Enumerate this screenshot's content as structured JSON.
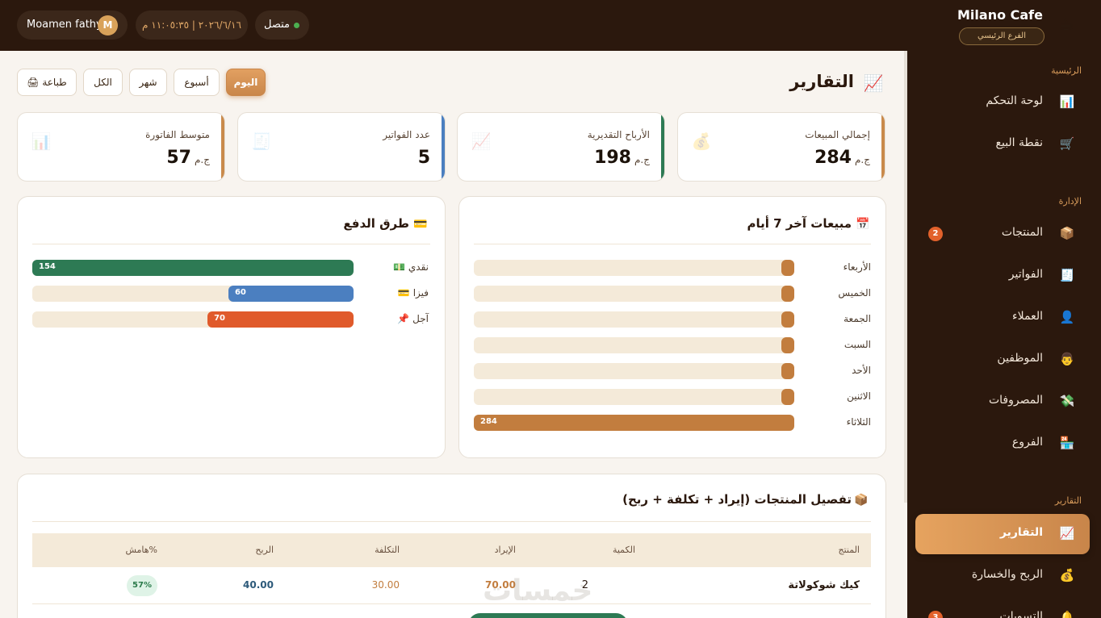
{
  "brand": {
    "title": "Milano Cafe",
    "branch": "الفرع الرئيسي",
    "icon": "coffee-cup-icon"
  },
  "topbar": {
    "status": "متصل",
    "datetime": "٢٠٢٦/٦/١٦ | ١١:٠٥:٣٥ م",
    "user_name": "Moamen fathy",
    "user_initial": "M"
  },
  "sidebar": {
    "sections": [
      {
        "title": "الرئيسية",
        "items": [
          {
            "label": "لوحة التحكم",
            "icon": "dashboard-icon"
          },
          {
            "label": "نقطة البيع",
            "icon": "cart-icon"
          }
        ]
      },
      {
        "title": "الإدارة",
        "items": [
          {
            "label": "المنتجات",
            "icon": "box-icon",
            "badge": "2"
          },
          {
            "label": "الفواتير",
            "icon": "receipt-icon"
          },
          {
            "label": "العملاء",
            "icon": "user-icon"
          },
          {
            "label": "الموظفين",
            "icon": "employee-icon"
          },
          {
            "label": "المصروفات",
            "icon": "money-wings-icon"
          },
          {
            "label": "الفروع",
            "icon": "store-icon"
          }
        ]
      },
      {
        "title": "التقارير",
        "items": [
          {
            "label": "التقارير",
            "icon": "chart-up-icon",
            "active": true
          },
          {
            "label": "الربح والخسارة",
            "icon": "money-bag-icon"
          },
          {
            "label": "التسويات",
            "icon": "bell-icon",
            "badge": "3"
          }
        ]
      }
    ]
  },
  "page": {
    "title": "التقارير",
    "icon": "chart-up-icon"
  },
  "filters": {
    "today": "اليوم",
    "week": "أسبوع",
    "month": "شهر",
    "all": "الكل",
    "print": "🖨 طباعة",
    "active": "today"
  },
  "stats": [
    {
      "label": "إجمالي المبيعات",
      "value": "284",
      "unit": "ج.م",
      "icon": "money-bag-icon",
      "accent": "#c98a4b"
    },
    {
      "label": "الأرباح التقديرية",
      "value": "198",
      "unit": "ج.م",
      "icon": "chart-up-icon",
      "accent": "#2d7a54"
    },
    {
      "label": "عدد الفواتير",
      "value": "5",
      "unit": "",
      "icon": "receipt-icon",
      "accent": "#4b7fc0"
    },
    {
      "label": "متوسط الفاتورة",
      "value": "57",
      "unit": "ج.م",
      "icon": "bar-chart-icon",
      "accent": "#c98a4b"
    }
  ],
  "sales_panel": {
    "title": "مبيعات آخر 7 أيام",
    "icon": "calendar-icon"
  },
  "payments_panel": {
    "title": "طرق الدفع",
    "icon": "credit-card-icon"
  },
  "chart_data": [
    {
      "type": "bar",
      "orientation": "horizontal",
      "title": "مبيعات آخر 7 أيام",
      "categories": [
        "الأربعاء",
        "الخميس",
        "الجمعة",
        "السبت",
        "الأحد",
        "الاثنين",
        "الثلاثاء"
      ],
      "values": [
        0,
        0,
        0,
        0,
        0,
        0,
        284
      ],
      "value_labels": [
        "",
        "",
        "",
        "",
        "",
        "",
        "284"
      ],
      "max": 284,
      "color": "#c27d3e"
    },
    {
      "type": "bar",
      "orientation": "horizontal",
      "title": "طرق الدفع",
      "categories": [
        "💵 نقدي",
        "💳 فيزا",
        "📌 آجل"
      ],
      "values": [
        154,
        60,
        70
      ],
      "value_labels": [
        "154",
        "60",
        "70"
      ],
      "max": 154,
      "colors": [
        "#2d7a54",
        "#4b7fc0",
        "#e05a2b"
      ]
    }
  ],
  "products_table": {
    "title": "تفصيل المنتجات (إيراد + تكلفة + ربح)",
    "icon": "box-icon",
    "columns": [
      "المنتج",
      "الكمية",
      "الإيراد",
      "التكلفة",
      "الربح",
      "هامش%"
    ],
    "rows": [
      {
        "product": "كيك شوكولاتة",
        "qty": "2",
        "revenue": "70.00",
        "cost": "30.00",
        "profit": "40.00",
        "margin": "57%"
      }
    ]
  },
  "watermark": "خمسات"
}
